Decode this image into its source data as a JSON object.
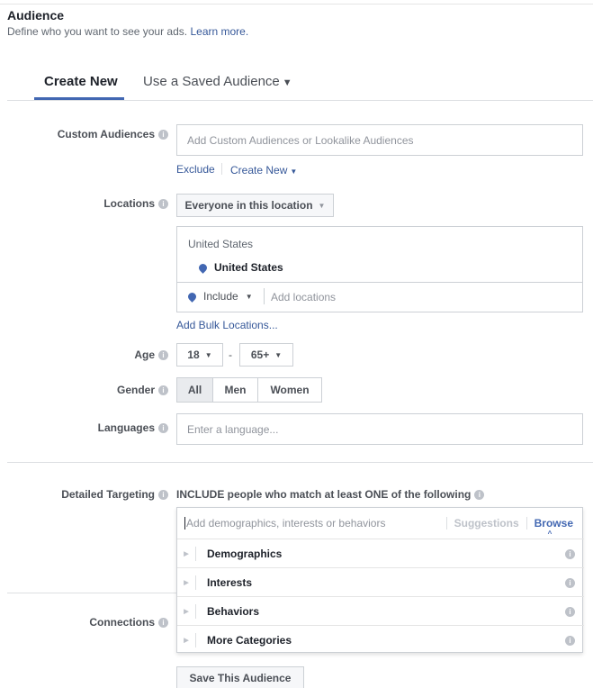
{
  "header": {
    "title": "Audience",
    "subtitle": "Define who you want to see your ads.",
    "learn_more": "Learn more."
  },
  "tabs": {
    "create_new": "Create New",
    "saved": "Use a Saved Audience"
  },
  "custom_audiences": {
    "label": "Custom Audiences",
    "placeholder": "Add Custom Audiences or Lookalike Audiences",
    "exclude": "Exclude",
    "create_new": "Create New"
  },
  "locations": {
    "label": "Locations",
    "mode": "Everyone in this location",
    "group_title": "United States",
    "selected": "United States",
    "include": "Include",
    "add_placeholder": "Add locations",
    "bulk": "Add Bulk Locations..."
  },
  "age": {
    "label": "Age",
    "min": "18",
    "dash": "-",
    "max": "65+"
  },
  "gender": {
    "label": "Gender",
    "options": [
      "All",
      "Men",
      "Women"
    ],
    "selected": "All"
  },
  "languages": {
    "label": "Languages",
    "placeholder": "Enter a language..."
  },
  "detailed_targeting": {
    "label": "Detailed Targeting",
    "include_text": "INCLUDE people who match at least ONE of the following",
    "placeholder": "Add demographics, interests or behaviors",
    "suggestions": "Suggestions",
    "browse": "Browse",
    "categories": [
      "Demographics",
      "Interests",
      "Behaviors",
      "More Categories"
    ]
  },
  "connections": {
    "label": "Connections"
  },
  "save_button": "Save This Audience",
  "colors": {
    "accent": "#4267b2",
    "link": "#365899"
  }
}
